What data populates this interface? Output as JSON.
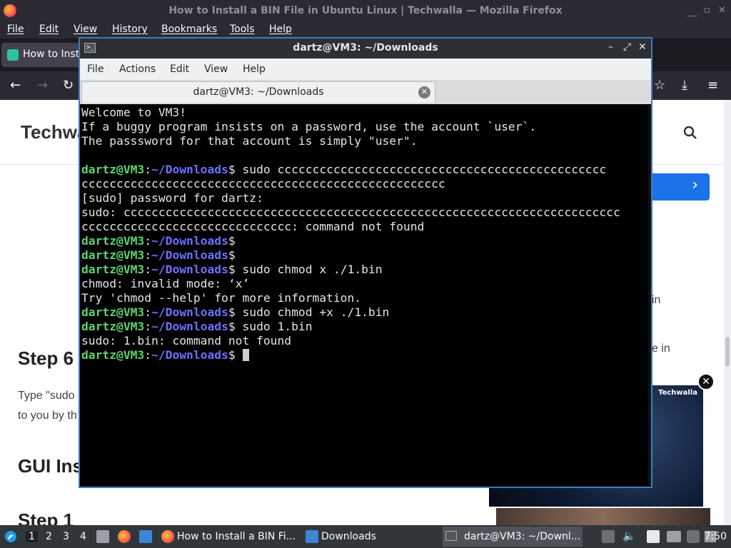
{
  "firefox": {
    "window_title": "How to Install a BIN File in Ubuntu Linux | Techwalla — Mozilla Firefox",
    "menu": [
      "File",
      "Edit",
      "View",
      "History",
      "Bookmarks",
      "Tools",
      "Help"
    ],
    "tab_label": "How to Insta",
    "page": {
      "logo": "Techwa",
      "step6": "Step 6",
      "type_sudo": "Type \"sudo",
      "to_you": "to you by th",
      "gui": "GUI Ins",
      "step1": "Step 1",
      "side1": "in",
      "side2": "e in",
      "video_brand": "Techwalla"
    }
  },
  "terminal": {
    "window_title": "dartz@VM3: ~/Downloads",
    "menu": [
      "File",
      "Actions",
      "Edit",
      "View",
      "Help"
    ],
    "tab_label": "dartz@VM3: ~/Downloads",
    "prompt_user": "dartz@VM3",
    "prompt_path": "~/Downloads",
    "lines": [
      {
        "text": "Welcome to VM3!"
      },
      {
        "text": "If a buggy program insists on a password, use the account `user`."
      },
      {
        "text": "The passsword for that account is simply \"user\"."
      },
      {
        "text": ""
      },
      {
        "prompt": true,
        "cmd": " sudo ccccccccccccccccccccccccccccccccccccccccccccccc"
      },
      {
        "text": "cccccccccccccccccccccccccccccccccccccccccccccccccccc"
      },
      {
        "text": "[sudo] password for dartz:"
      },
      {
        "text": "sudo: ccccccccccccccccccccccccccccccccccccccccccccccccccccccccccccccccccccccc"
      },
      {
        "text": "cccccccccccccccccccccccccccccc: command not found"
      },
      {
        "prompt": true,
        "cmd": ""
      },
      {
        "prompt": true,
        "cmd": ""
      },
      {
        "prompt": true,
        "cmd": " sudo chmod x ./1.bin"
      },
      {
        "text": "chmod: invalid mode: ‘x’"
      },
      {
        "text": "Try 'chmod --help' for more information."
      },
      {
        "prompt": true,
        "cmd": " sudo chmod +x ./1.bin"
      },
      {
        "prompt": true,
        "cmd": " sudo 1.bin"
      },
      {
        "text": "sudo: 1.bin: command not found"
      },
      {
        "prompt": true,
        "cmd": " ",
        "cursor": true
      }
    ]
  },
  "taskbar": {
    "workspaces": [
      "1",
      "2",
      "3",
      "4"
    ],
    "tasks": [
      "How to Install a BIN Fi...",
      "Downloads",
      "dartz@VM3: ~/Downl..."
    ],
    "clock": "7:50"
  },
  "colors": {
    "prompt_user": "#5dd36d",
    "prompt_path": "#6d70ff",
    "terminal_bg": "#000000",
    "firefox_chrome": "#2b2a33",
    "taskbar": "#31363b"
  }
}
